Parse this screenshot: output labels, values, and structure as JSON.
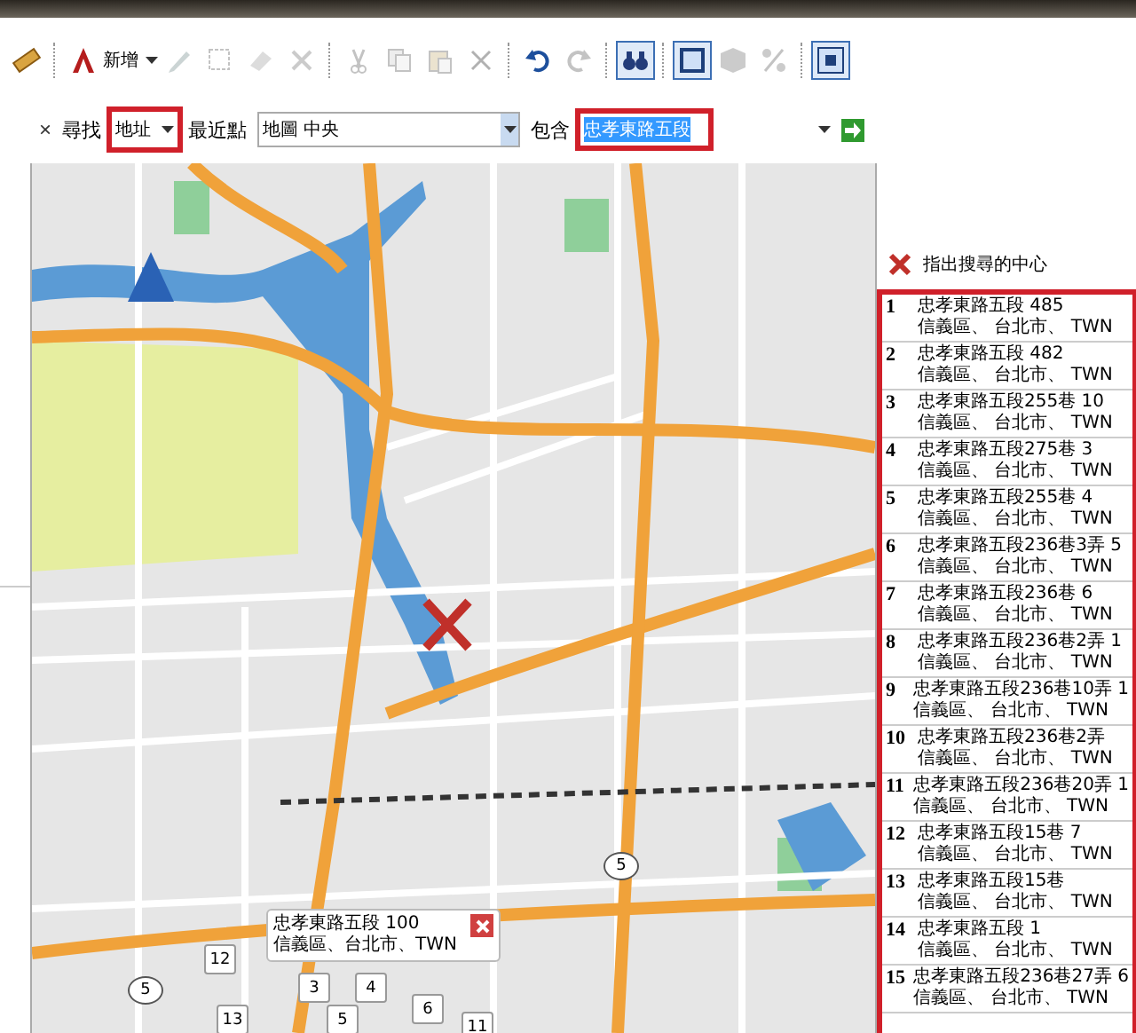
{
  "toolbar": {
    "groups": [
      [
        {
          "kind": "ruler",
          "selected": false,
          "disabled": false
        }
      ],
      [
        {
          "kind": "new",
          "label": "新增",
          "selected": false,
          "disabled": false
        },
        {
          "kind": "pencil",
          "selected": false,
          "disabled": true
        },
        {
          "kind": "select",
          "selected": false,
          "disabled": true
        },
        {
          "kind": "eraser",
          "selected": false,
          "disabled": true
        },
        {
          "kind": "scissors",
          "selected": false,
          "disabled": true
        }
      ],
      [
        {
          "kind": "cut",
          "selected": false,
          "disabled": true
        },
        {
          "kind": "copy",
          "selected": false,
          "disabled": true
        },
        {
          "kind": "paste",
          "selected": false,
          "disabled": true
        },
        {
          "kind": "delete",
          "selected": false,
          "disabled": true
        }
      ],
      [
        {
          "kind": "undo",
          "selected": false,
          "disabled": false
        },
        {
          "kind": "redo",
          "selected": false,
          "disabled": true
        }
      ],
      [
        {
          "kind": "binoculars",
          "selected": true,
          "disabled": false
        }
      ],
      [
        {
          "kind": "square",
          "selected": true,
          "disabled": false
        },
        {
          "kind": "cube",
          "selected": false,
          "disabled": true
        },
        {
          "kind": "percent",
          "selected": false,
          "disabled": true
        }
      ],
      [
        {
          "kind": "fit",
          "selected": true,
          "disabled": false
        }
      ]
    ]
  },
  "search": {
    "close": "×",
    "find_label": "尋找",
    "find_type": {
      "value": "地址",
      "highlighted": true
    },
    "near_label": "最近點",
    "near": {
      "value": "地圖 中央"
    },
    "contains_label": "包含",
    "contains": {
      "value": "忠孝東路五段",
      "highlighted": true,
      "text_selected": true
    }
  },
  "map": {
    "popup": {
      "title": "忠孝東路五段 100",
      "subtitle": "信義區、台北市、TWN"
    },
    "markers": [
      {
        "label": "12"
      },
      {
        "label": "3"
      },
      {
        "label": "4"
      },
      {
        "label": "13"
      },
      {
        "label": "5"
      },
      {
        "label": "6"
      },
      {
        "label": "11"
      }
    ],
    "shields": [
      {
        "label": "5"
      },
      {
        "label": "5"
      }
    ]
  },
  "results_panel": {
    "center_button": {
      "label": "指出搜尋的中心"
    },
    "highlighted": true,
    "items": [
      {
        "number": "1",
        "line1": "忠孝東路五段 485",
        "line2": "信義區、 台北市、 TWN"
      },
      {
        "number": "2",
        "line1": "忠孝東路五段 482",
        "line2": "信義區、 台北市、 TWN"
      },
      {
        "number": "3",
        "line1": "忠孝東路五段255巷 10",
        "line2": "信義區、 台北市、 TWN"
      },
      {
        "number": "4",
        "line1": "忠孝東路五段275巷 3",
        "line2": "信義區、 台北市、 TWN"
      },
      {
        "number": "5",
        "line1": "忠孝東路五段255巷 4",
        "line2": "信義區、 台北市、 TWN"
      },
      {
        "number": "6",
        "line1": "忠孝東路五段236巷3弄 5",
        "line2": "信義區、 台北市、 TWN"
      },
      {
        "number": "7",
        "line1": "忠孝東路五段236巷 6",
        "line2": "信義區、 台北市、 TWN"
      },
      {
        "number": "8",
        "line1": "忠孝東路五段236巷2弄 1",
        "line2": "信義區、 台北市、 TWN"
      },
      {
        "number": "9",
        "line1": "忠孝東路五段236巷10弄 1",
        "line2": "信義區、 台北市、 TWN"
      },
      {
        "number": "10",
        "line1": "忠孝東路五段236巷2弄",
        "line2": "信義區、 台北市、 TWN"
      },
      {
        "number": "11",
        "line1": "忠孝東路五段236巷20弄 1",
        "line2": "信義區、 台北市、 TWN"
      },
      {
        "number": "12",
        "line1": "忠孝東路五段15巷 7",
        "line2": "信義區、 台北市、 TWN"
      },
      {
        "number": "13",
        "line1": "忠孝東路五段15巷",
        "line2": "信義區、 台北市、 TWN"
      },
      {
        "number": "14",
        "line1": "忠孝東路五段 1",
        "line2": "信義區、 台北市、 TWN"
      },
      {
        "number": "15",
        "line1": "忠孝東路五段236巷27弄 6",
        "line2": "信義區、 台北市、 TWN"
      }
    ]
  }
}
